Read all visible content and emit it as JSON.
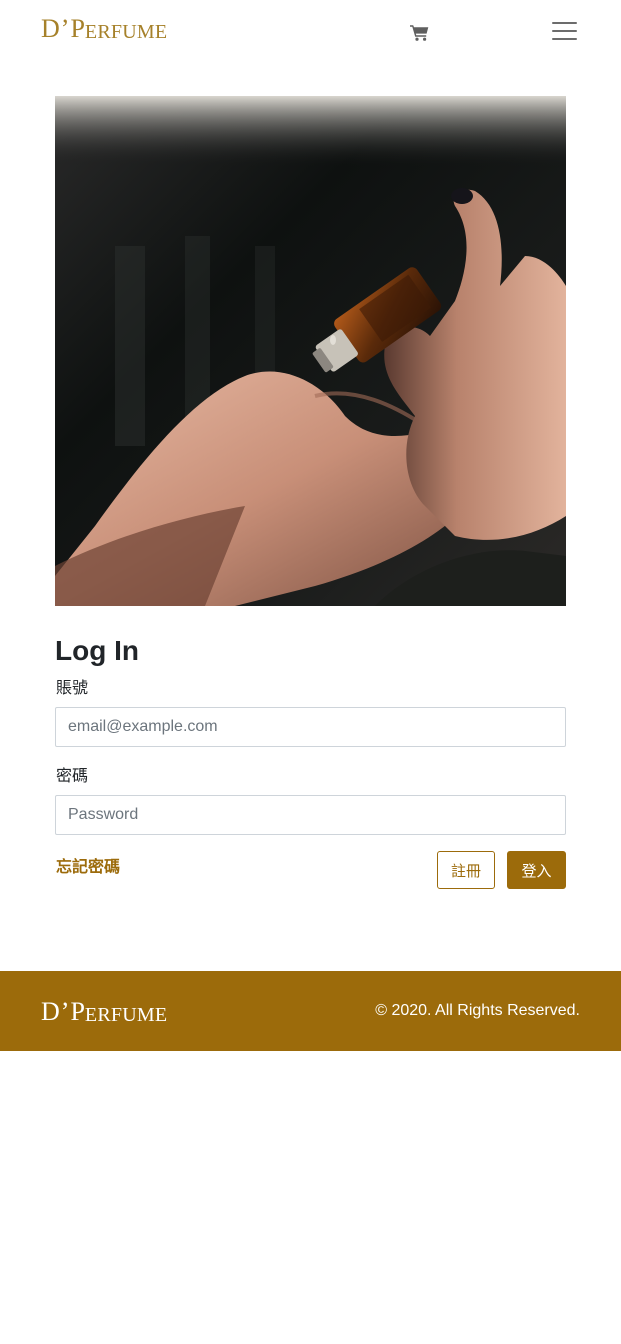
{
  "brand": {
    "logo_first": "D",
    "logo_apostrophe": "’",
    "logo_p": "P",
    "logo_rest": "ERFUME",
    "logo_color": "#a6812a"
  },
  "header": {
    "cart_icon": "shopping-cart-icon",
    "menu_icon": "hamburger-menu-icon"
  },
  "hero": {
    "image_subject": "hands with perfume oil dropper bottle"
  },
  "login": {
    "title": "Log In",
    "account_label": "賬號",
    "account_placeholder": "email@example.com",
    "password_label": "密碼",
    "password_placeholder": "Password",
    "forgot_link": "忘記密碼",
    "register_button": "註冊",
    "login_button": "登入"
  },
  "footer": {
    "copyright": "© 2020. All Rights Reserved.",
    "background_color": "#9c6b0b"
  },
  "colors": {
    "accent": "#9c6b0b",
    "text": "#212529"
  }
}
